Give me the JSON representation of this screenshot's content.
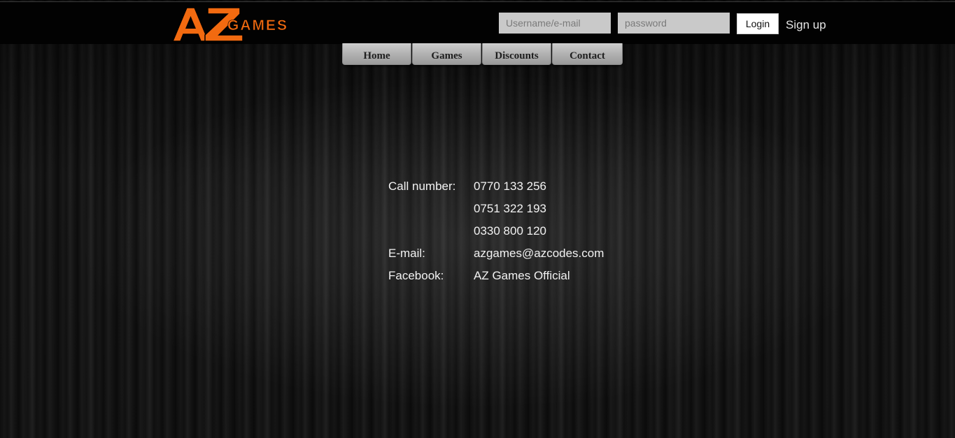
{
  "header": {
    "logo_text_main": "AZ",
    "logo_text_sub": "GAMES",
    "brand_color": "#f26a10",
    "username_placeholder": "Username/e-mail",
    "password_placeholder": "password",
    "login_label": "Login",
    "signup_label": "Sign up"
  },
  "nav": {
    "items": [
      {
        "label": "Home"
      },
      {
        "label": "Games"
      },
      {
        "label": "Discounts"
      },
      {
        "label": "Contact"
      }
    ]
  },
  "contact": {
    "rows": [
      {
        "label": "Call number:",
        "value": "0770 133 256"
      },
      {
        "label": "",
        "value": "0751 322 193"
      },
      {
        "label": "",
        "value": "0330 800 120"
      },
      {
        "label": "E-mail:",
        "value": "azgames@azcodes.com"
      },
      {
        "label": "Facebook:",
        "value": "AZ Games Official"
      }
    ]
  }
}
